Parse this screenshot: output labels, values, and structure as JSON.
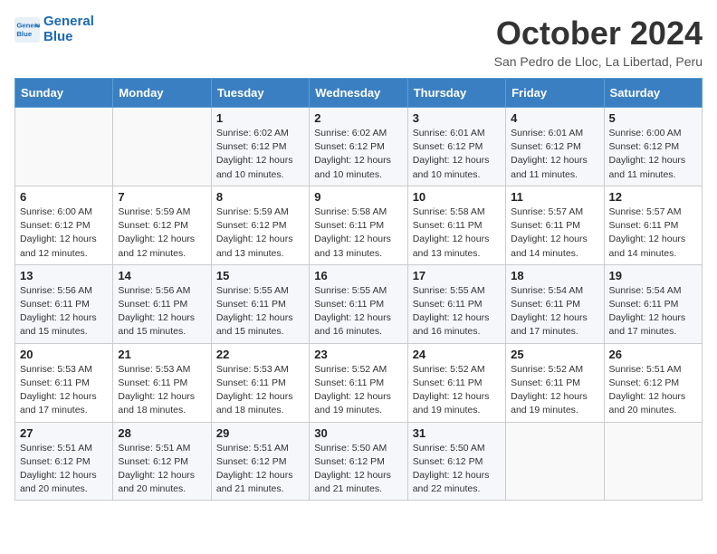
{
  "header": {
    "logo_line1": "General",
    "logo_line2": "Blue",
    "month": "October 2024",
    "location": "San Pedro de Lloc, La Libertad, Peru"
  },
  "days_of_week": [
    "Sunday",
    "Monday",
    "Tuesday",
    "Wednesday",
    "Thursday",
    "Friday",
    "Saturday"
  ],
  "weeks": [
    [
      {
        "day": "",
        "info": ""
      },
      {
        "day": "",
        "info": ""
      },
      {
        "day": "1",
        "info": "Sunrise: 6:02 AM\nSunset: 6:12 PM\nDaylight: 12 hours\nand 10 minutes."
      },
      {
        "day": "2",
        "info": "Sunrise: 6:02 AM\nSunset: 6:12 PM\nDaylight: 12 hours\nand 10 minutes."
      },
      {
        "day": "3",
        "info": "Sunrise: 6:01 AM\nSunset: 6:12 PM\nDaylight: 12 hours\nand 10 minutes."
      },
      {
        "day": "4",
        "info": "Sunrise: 6:01 AM\nSunset: 6:12 PM\nDaylight: 12 hours\nand 11 minutes."
      },
      {
        "day": "5",
        "info": "Sunrise: 6:00 AM\nSunset: 6:12 PM\nDaylight: 12 hours\nand 11 minutes."
      }
    ],
    [
      {
        "day": "6",
        "info": "Sunrise: 6:00 AM\nSunset: 6:12 PM\nDaylight: 12 hours\nand 12 minutes."
      },
      {
        "day": "7",
        "info": "Sunrise: 5:59 AM\nSunset: 6:12 PM\nDaylight: 12 hours\nand 12 minutes."
      },
      {
        "day": "8",
        "info": "Sunrise: 5:59 AM\nSunset: 6:12 PM\nDaylight: 12 hours\nand 13 minutes."
      },
      {
        "day": "9",
        "info": "Sunrise: 5:58 AM\nSunset: 6:11 PM\nDaylight: 12 hours\nand 13 minutes."
      },
      {
        "day": "10",
        "info": "Sunrise: 5:58 AM\nSunset: 6:11 PM\nDaylight: 12 hours\nand 13 minutes."
      },
      {
        "day": "11",
        "info": "Sunrise: 5:57 AM\nSunset: 6:11 PM\nDaylight: 12 hours\nand 14 minutes."
      },
      {
        "day": "12",
        "info": "Sunrise: 5:57 AM\nSunset: 6:11 PM\nDaylight: 12 hours\nand 14 minutes."
      }
    ],
    [
      {
        "day": "13",
        "info": "Sunrise: 5:56 AM\nSunset: 6:11 PM\nDaylight: 12 hours\nand 15 minutes."
      },
      {
        "day": "14",
        "info": "Sunrise: 5:56 AM\nSunset: 6:11 PM\nDaylight: 12 hours\nand 15 minutes."
      },
      {
        "day": "15",
        "info": "Sunrise: 5:55 AM\nSunset: 6:11 PM\nDaylight: 12 hours\nand 15 minutes."
      },
      {
        "day": "16",
        "info": "Sunrise: 5:55 AM\nSunset: 6:11 PM\nDaylight: 12 hours\nand 16 minutes."
      },
      {
        "day": "17",
        "info": "Sunrise: 5:55 AM\nSunset: 6:11 PM\nDaylight: 12 hours\nand 16 minutes."
      },
      {
        "day": "18",
        "info": "Sunrise: 5:54 AM\nSunset: 6:11 PM\nDaylight: 12 hours\nand 17 minutes."
      },
      {
        "day": "19",
        "info": "Sunrise: 5:54 AM\nSunset: 6:11 PM\nDaylight: 12 hours\nand 17 minutes."
      }
    ],
    [
      {
        "day": "20",
        "info": "Sunrise: 5:53 AM\nSunset: 6:11 PM\nDaylight: 12 hours\nand 17 minutes."
      },
      {
        "day": "21",
        "info": "Sunrise: 5:53 AM\nSunset: 6:11 PM\nDaylight: 12 hours\nand 18 minutes."
      },
      {
        "day": "22",
        "info": "Sunrise: 5:53 AM\nSunset: 6:11 PM\nDaylight: 12 hours\nand 18 minutes."
      },
      {
        "day": "23",
        "info": "Sunrise: 5:52 AM\nSunset: 6:11 PM\nDaylight: 12 hours\nand 19 minutes."
      },
      {
        "day": "24",
        "info": "Sunrise: 5:52 AM\nSunset: 6:11 PM\nDaylight: 12 hours\nand 19 minutes."
      },
      {
        "day": "25",
        "info": "Sunrise: 5:52 AM\nSunset: 6:11 PM\nDaylight: 12 hours\nand 19 minutes."
      },
      {
        "day": "26",
        "info": "Sunrise: 5:51 AM\nSunset: 6:12 PM\nDaylight: 12 hours\nand 20 minutes."
      }
    ],
    [
      {
        "day": "27",
        "info": "Sunrise: 5:51 AM\nSunset: 6:12 PM\nDaylight: 12 hours\nand 20 minutes."
      },
      {
        "day": "28",
        "info": "Sunrise: 5:51 AM\nSunset: 6:12 PM\nDaylight: 12 hours\nand 20 minutes."
      },
      {
        "day": "29",
        "info": "Sunrise: 5:51 AM\nSunset: 6:12 PM\nDaylight: 12 hours\nand 21 minutes."
      },
      {
        "day": "30",
        "info": "Sunrise: 5:50 AM\nSunset: 6:12 PM\nDaylight: 12 hours\nand 21 minutes."
      },
      {
        "day": "31",
        "info": "Sunrise: 5:50 AM\nSunset: 6:12 PM\nDaylight: 12 hours\nand 22 minutes."
      },
      {
        "day": "",
        "info": ""
      },
      {
        "day": "",
        "info": ""
      }
    ]
  ]
}
